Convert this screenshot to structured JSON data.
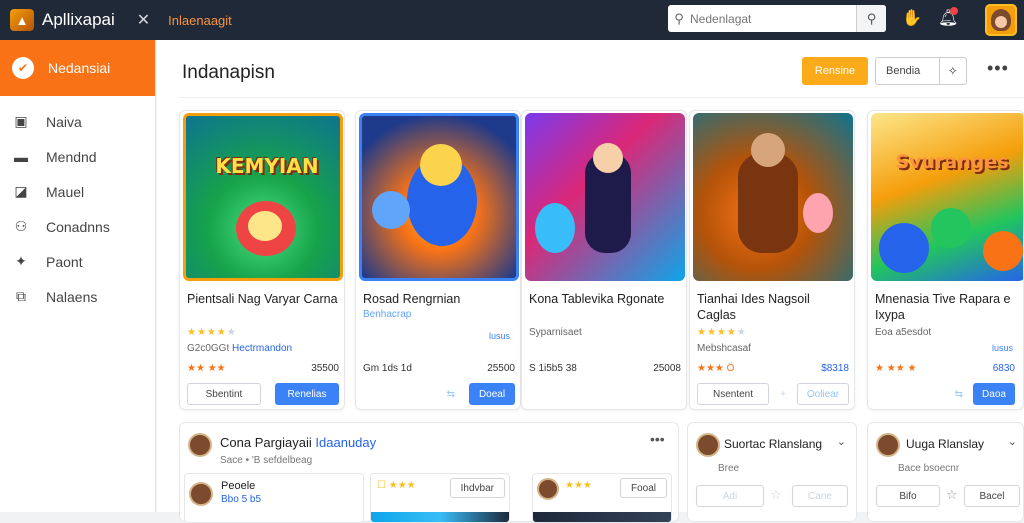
{
  "app": {
    "name": "Apllixapai",
    "top_link": "Inlaenaagit"
  },
  "search": {
    "placeholder": "Nedenlagat"
  },
  "sidebar": {
    "active": "Nedansiai",
    "items": [
      {
        "label": "Naiva",
        "icon": "image-icon"
      },
      {
        "label": "Mendnd",
        "icon": "card-icon"
      },
      {
        "label": "Mauel",
        "icon": "chart-icon"
      },
      {
        "label": "Conadnns",
        "icon": "users-icon"
      },
      {
        "label": "Paont",
        "icon": "pin-icon"
      },
      {
        "label": "Nalaens",
        "icon": "briefcase-icon"
      }
    ]
  },
  "header": {
    "title": "Indanapisn",
    "orange_button": "Rensine",
    "outline_button": "Bendia",
    "outline_icon": "✧"
  },
  "cards": [
    {
      "thumb_title": "KEMYIAN",
      "title": "Pientsali Nag Varyar Carna",
      "rating_on": "★★★★",
      "rating_off": "★",
      "meta_a": "G2c0GGt",
      "meta_b": "Hectrmandon",
      "right_note": "",
      "row3_left": "★★ ★★",
      "row3_right": "35500",
      "btn1": "Sbentint",
      "btn2": "Renelias",
      "btn2_style": "blue"
    },
    {
      "thumb_title": "",
      "title": "Rosad Rengrnian",
      "rating_on": "",
      "rating_off": "",
      "meta_a": "Benhacrap",
      "meta_b": "",
      "right_note": "lusus",
      "row3_left": "Gm 1ds 1d",
      "row3_right": "25500",
      "btn1": "",
      "btn2": "Doeal",
      "btn2_style": "blue"
    },
    {
      "thumb_title": "",
      "title": "Kona Tablevika Rgonate",
      "rating_on": "",
      "rating_off": "",
      "meta_a": "Syparnisaet",
      "meta_b": "",
      "right_note": "",
      "row3_left": "S 1i5b5 38",
      "row3_right": "25008",
      "btn1": "",
      "btn2": "",
      "btn2_style": "none"
    },
    {
      "thumb_title": "",
      "title": "Tianhai Ides Nagsoil Caglas",
      "rating_on": "★★★★",
      "rating_off": "★",
      "meta_a": "Mebshcasaf",
      "meta_b": "",
      "right_note": "",
      "row3_left": "★★★ Ö",
      "row3_right": "$8318",
      "btn1": "Nsentent",
      "btn2": "Ooliear",
      "btn2_style": "ghost"
    },
    {
      "thumb_title": "Svuranges",
      "title": "Mnenasia Tive Rapara e Ixypa",
      "rating_on": "",
      "rating_off": "",
      "meta_a": "Eoa a5esdot",
      "meta_b": "",
      "right_note": "lusus",
      "row3_left": "★ ★★ ★",
      "row3_right": "6830",
      "btn1": "",
      "btn2": "Daoa",
      "btn2_style": "blue"
    }
  ],
  "bottom": {
    "feed_title_a": "Cona Pargiayaii",
    "feed_title_b": "Idaanuday",
    "feed_sub": "Sace • 'B sefdelbeag",
    "feed_user": "Peoele",
    "feed_user_sub": "Bbo 5 b5",
    "mini1_label": "Ihdvbar",
    "mini2_label": "Fooal",
    "panel2_title": "Suortac Rlanslang",
    "panel2_sub": "Bree",
    "panel2_b1": "Adi",
    "panel2_b2": "Cane",
    "panel3_title": "Uuga Rlanslay",
    "panel3_sub": "Bace bsoecnr",
    "panel3_b1": "Bifo",
    "panel3_b2": "Bacel"
  },
  "colors": {
    "accent": "#f97316",
    "topbar": "#1f2937",
    "primary": "#3b82f6"
  }
}
